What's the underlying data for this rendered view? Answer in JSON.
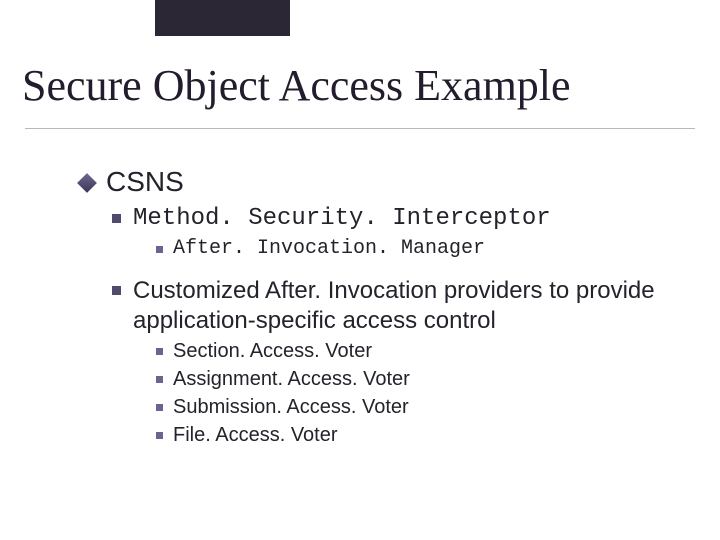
{
  "title": "Secure Object Access Example",
  "b1_csns": "CSNS",
  "b2_method": "Method. Security. Interceptor",
  "b3_after": "After. Invocation. Manager",
  "b2_custom": "Customized After. Invocation providers to provide application-specific access control",
  "voters": {
    "v0": "Section. Access. Voter",
    "v1": "Assignment. Access. Voter",
    "v2": "Submission. Access. Voter",
    "v3": "File. Access. Voter"
  }
}
